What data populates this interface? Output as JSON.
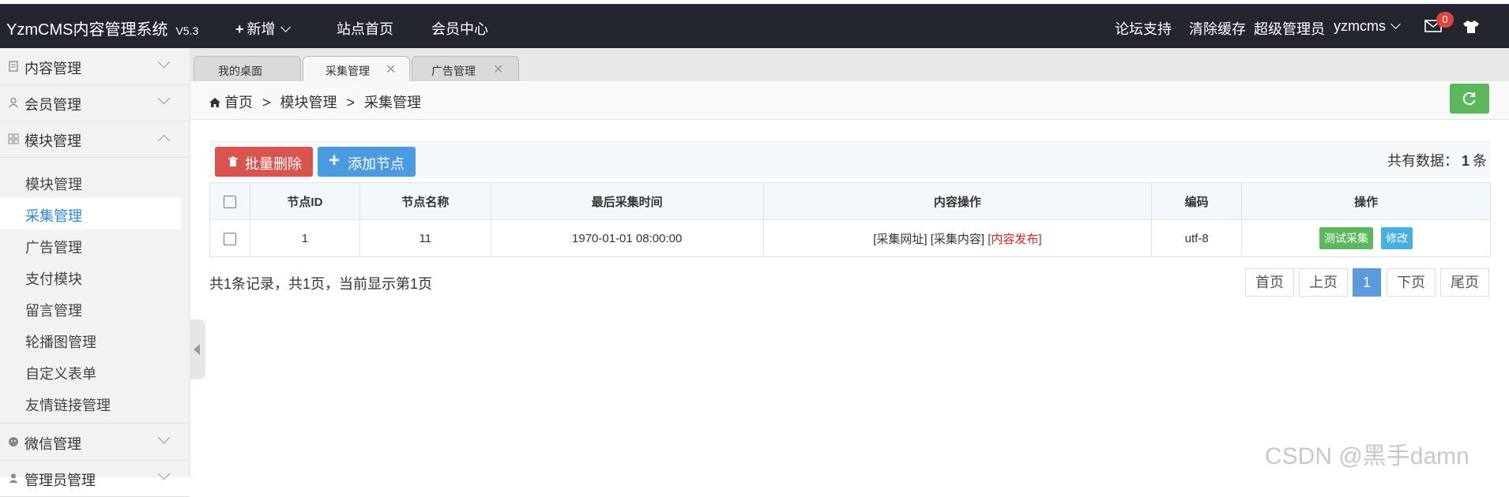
{
  "topbar": {
    "brand": "YzmCMS内容管理系统",
    "version": "V5.3",
    "nav": [
      "新增",
      "站点首页",
      "会员中心"
    ],
    "right": [
      "论坛支持",
      "清除缓存",
      "超级管理员",
      "yzmcms"
    ],
    "mail_count": "0",
    "icons": [
      "mail-icon",
      "tshirt-icon"
    ]
  },
  "sidebar": {
    "groups": [
      "内容管理",
      "会员管理",
      "模块管理",
      "微信管理",
      "管理员管理"
    ],
    "subitems": [
      "模块管理",
      "采集管理",
      "广告管理",
      "支付模块",
      "留言管理",
      "轮播图管理",
      "自定义表单",
      "友情链接管理"
    ],
    "active_subitem": "采集管理"
  },
  "tabs": [
    "我的桌面",
    "采集管理",
    "广告管理"
  ],
  "breadcrumb": [
    "首页",
    "模块管理",
    "采集管理"
  ],
  "toolbar": {
    "delete_label": "批量删除",
    "add_label": "添加节点",
    "total_prefix": "共有数据：",
    "total_count": "1",
    "total_suffix": "条"
  },
  "table": {
    "headers": [
      "节点ID",
      "节点名称",
      "最后采集时间",
      "内容操作",
      "编码",
      "操作"
    ],
    "rows": [
      {
        "id": "1",
        "name": "11",
        "time": "1970-01-01 08:00:00",
        "op1": "[采集网址]",
        "op2": "[采集内容]",
        "op3": "[内容发布]",
        "encoding": "utf-8",
        "act1": "测试采集",
        "act2": "修改"
      }
    ]
  },
  "pagination": {
    "info": "共1条记录，共1页，当前显示第1页",
    "first": "首页",
    "prev": "上页",
    "current": "1",
    "next": "下页",
    "last": "尾页"
  },
  "watermark": "CSDN @黑手damn",
  "colors": {
    "topbar": "#23262e",
    "delete": "#d9534f",
    "add": "#4c9ae0",
    "refresh": "#5cb85c",
    "active_link": "#2b8ad8"
  }
}
